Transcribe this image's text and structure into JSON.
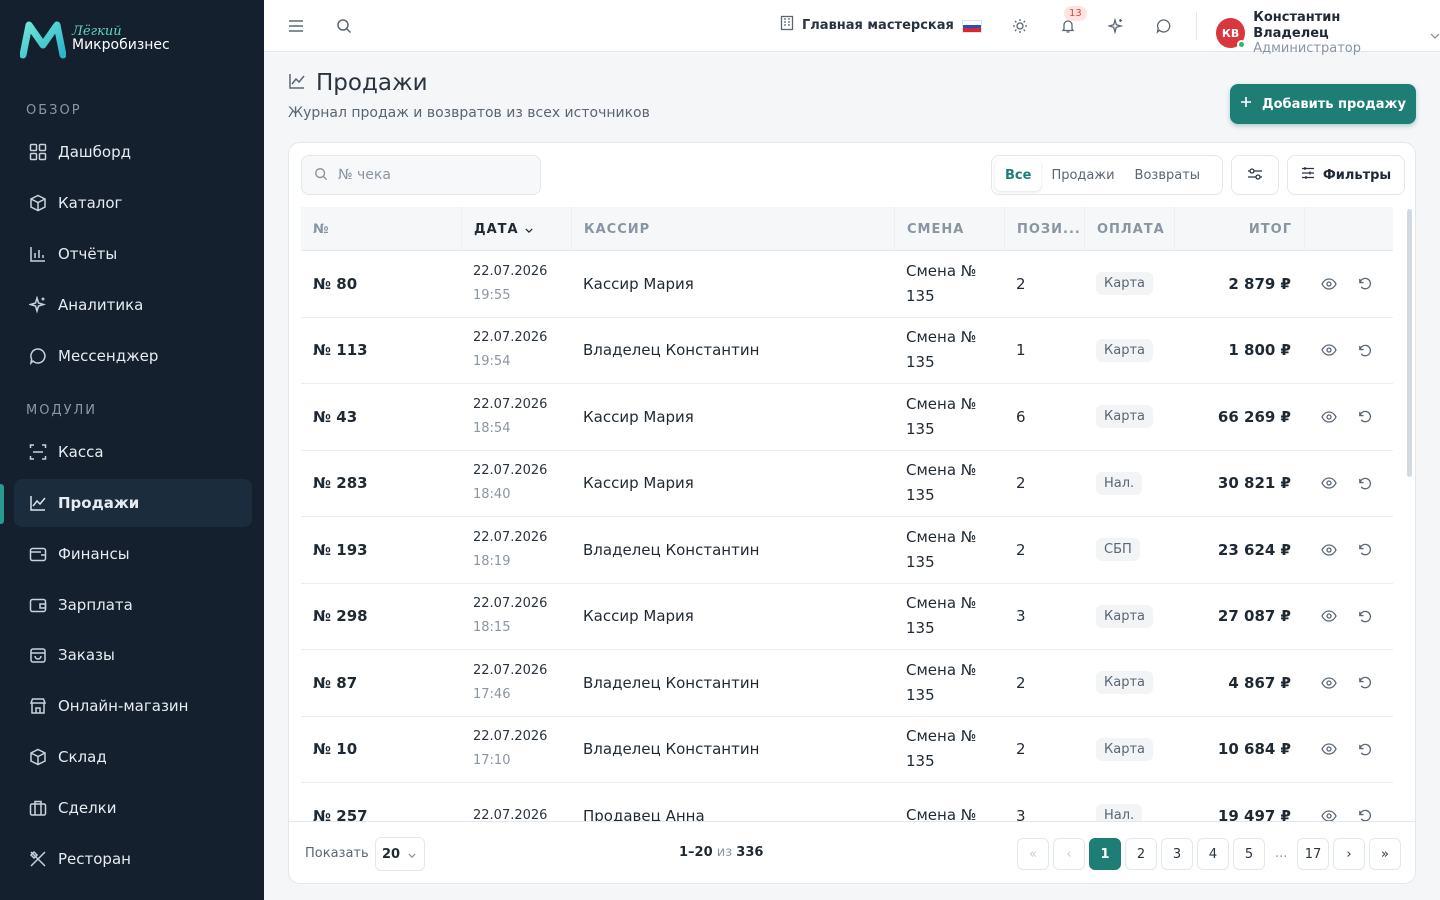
{
  "brand": {
    "line1": "Лёгкий",
    "line2": "Микробизнес"
  },
  "sidebar": {
    "section_overview": "ОБЗОР",
    "section_modules": "МОДУЛИ",
    "items": [
      {
        "label": "Дашборд",
        "icon": "grid-icon"
      },
      {
        "label": "Каталог",
        "icon": "box-icon"
      },
      {
        "label": "Отчёты",
        "icon": "bar-chart-icon"
      },
      {
        "label": "Аналитика",
        "icon": "sparkle-icon"
      },
      {
        "label": "Мессенджер",
        "icon": "chat-icon"
      },
      {
        "label": "Касса",
        "icon": "scan-icon"
      },
      {
        "label": "Продажи",
        "icon": "line-chart-icon",
        "active": true
      },
      {
        "label": "Финансы",
        "icon": "wallet-icon"
      },
      {
        "label": "Зарплата",
        "icon": "wallet-icon"
      },
      {
        "label": "Заказы",
        "icon": "bag-icon"
      },
      {
        "label": "Онлайн-магазин",
        "icon": "store-icon"
      },
      {
        "label": "Склад",
        "icon": "cube-icon"
      },
      {
        "label": "Сделки",
        "icon": "briefcase-icon"
      },
      {
        "label": "Ресторан",
        "icon": "utensils-icon"
      }
    ]
  },
  "topbar": {
    "workshop": "Главная мастерская",
    "notifications": "13",
    "user_initials": "КВ",
    "user_name": "Константин Владелец",
    "user_role": "Администратор"
  },
  "page": {
    "title": "Продажи",
    "subtitle": "Журнал продаж и возвратов из всех источников",
    "add_button": "Добавить продажу"
  },
  "toolbar": {
    "search_placeholder": "№ чека",
    "seg_all": "Все",
    "seg_sales": "Продажи",
    "seg_returns": "Возвраты",
    "filters": "Фильтры"
  },
  "table": {
    "headers": {
      "num": "№",
      "date": "ДАТА",
      "cashier": "КАССИР",
      "shift": "СМЕНА",
      "positions": "ПОЗИ...",
      "payment": "ОПЛАТА",
      "total": "ИТОГ"
    },
    "rows": [
      {
        "num": "№ 80",
        "date": "22.07.2026",
        "time": "19:55",
        "cashier": "Кассир Мария",
        "shift": "Смена № 135",
        "positions": "2",
        "payment": "Карта",
        "total": "2 879 ₽"
      },
      {
        "num": "№ 113",
        "date": "22.07.2026",
        "time": "19:54",
        "cashier": "Владелец Константин",
        "shift": "Смена № 135",
        "positions": "1",
        "payment": "Карта",
        "total": "1 800 ₽"
      },
      {
        "num": "№ 43",
        "date": "22.07.2026",
        "time": "18:54",
        "cashier": "Кассир Мария",
        "shift": "Смена № 135",
        "positions": "6",
        "payment": "Карта",
        "total": "66 269 ₽"
      },
      {
        "num": "№ 283",
        "date": "22.07.2026",
        "time": "18:40",
        "cashier": "Кассир Мария",
        "shift": "Смена № 135",
        "positions": "2",
        "payment": "Нал.",
        "total": "30 821 ₽"
      },
      {
        "num": "№ 193",
        "date": "22.07.2026",
        "time": "18:19",
        "cashier": "Владелец Константин",
        "shift": "Смена № 135",
        "positions": "2",
        "payment": "СБП",
        "total": "23 624 ₽"
      },
      {
        "num": "№ 298",
        "date": "22.07.2026",
        "time": "18:15",
        "cashier": "Кассир Мария",
        "shift": "Смена № 135",
        "positions": "3",
        "payment": "Карта",
        "total": "27 087 ₽"
      },
      {
        "num": "№ 87",
        "date": "22.07.2026",
        "time": "17:46",
        "cashier": "Владелец Константин",
        "shift": "Смена № 135",
        "positions": "2",
        "payment": "Карта",
        "total": "4 867 ₽"
      },
      {
        "num": "№ 10",
        "date": "22.07.2026",
        "time": "17:10",
        "cashier": "Владелец Константин",
        "shift": "Смена № 135",
        "positions": "2",
        "payment": "Карта",
        "total": "10 684 ₽"
      },
      {
        "num": "№ 257",
        "date": "22.07.2026",
        "time": "",
        "cashier": "Продавец Анна",
        "shift": "Смена №",
        "positions": "3",
        "payment": "Нал.",
        "total": "19 497 ₽"
      }
    ]
  },
  "footer": {
    "show_label": "Показать",
    "page_size": "20",
    "range": "1–20",
    "of": "из",
    "total": "336",
    "pages": [
      "1",
      "2",
      "3",
      "4",
      "5"
    ],
    "ellipsis": "...",
    "last_page": "17"
  },
  "colors": {
    "accent": "#1e7d74",
    "sidebar_bg": "#14202e",
    "badge_bg": "#fde3e1",
    "avatar": "#d9363e"
  }
}
